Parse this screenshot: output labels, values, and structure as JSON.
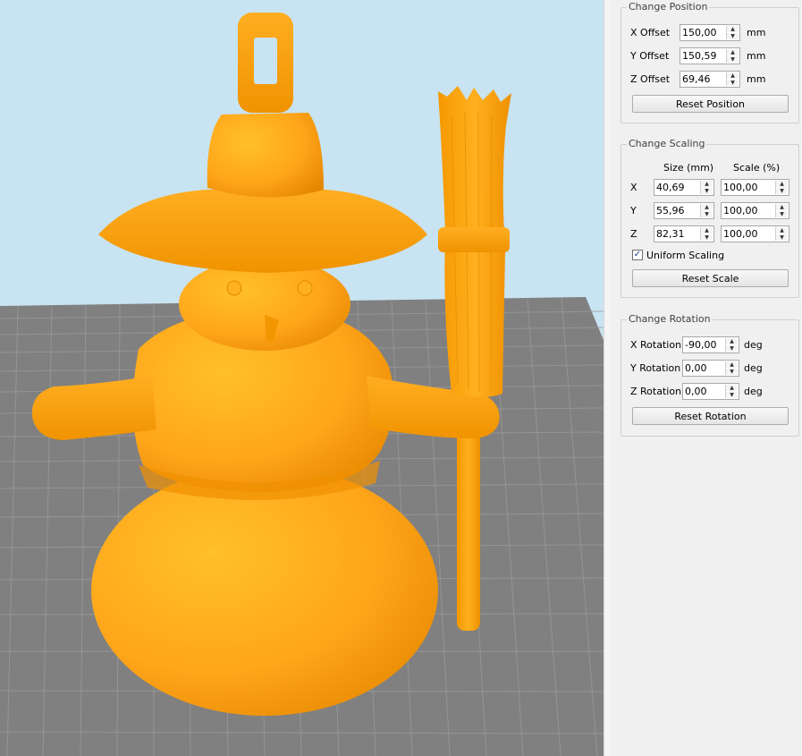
{
  "position": {
    "title": "Change Position",
    "x_label": "X Offset",
    "x_value": "150,00",
    "x_unit": "mm",
    "y_label": "Y Offset",
    "y_value": "150,59",
    "y_unit": "mm",
    "z_label": "Z Offset",
    "z_value": "69,46",
    "z_unit": "mm",
    "reset_label": "Reset Position"
  },
  "scaling": {
    "title": "Change Scaling",
    "size_header": "Size (mm)",
    "scale_header": "Scale (%)",
    "rows": [
      {
        "axis": "X",
        "size": "40,69",
        "scale": "100,00"
      },
      {
        "axis": "Y",
        "size": "55,96",
        "scale": "100,00"
      },
      {
        "axis": "Z",
        "size": "82,31",
        "scale": "100,00"
      }
    ],
    "uniform_label": "Uniform Scaling",
    "uniform_checked": true,
    "reset_label": "Reset Scale"
  },
  "rotation": {
    "title": "Change Rotation",
    "x_label": "X Rotation",
    "x_value": "-90,00",
    "x_unit": "deg",
    "y_label": "Y Rotation",
    "y_value": "0,00",
    "y_unit": "deg",
    "z_label": "Z Rotation",
    "z_value": "0,00",
    "z_unit": "deg",
    "reset_label": "Reset Rotation"
  },
  "viewport": {
    "model_color": "#ffa51a",
    "bed_color": "#808080",
    "grid_color": "#9a9a9a",
    "background_color": "#c8e3f1"
  }
}
